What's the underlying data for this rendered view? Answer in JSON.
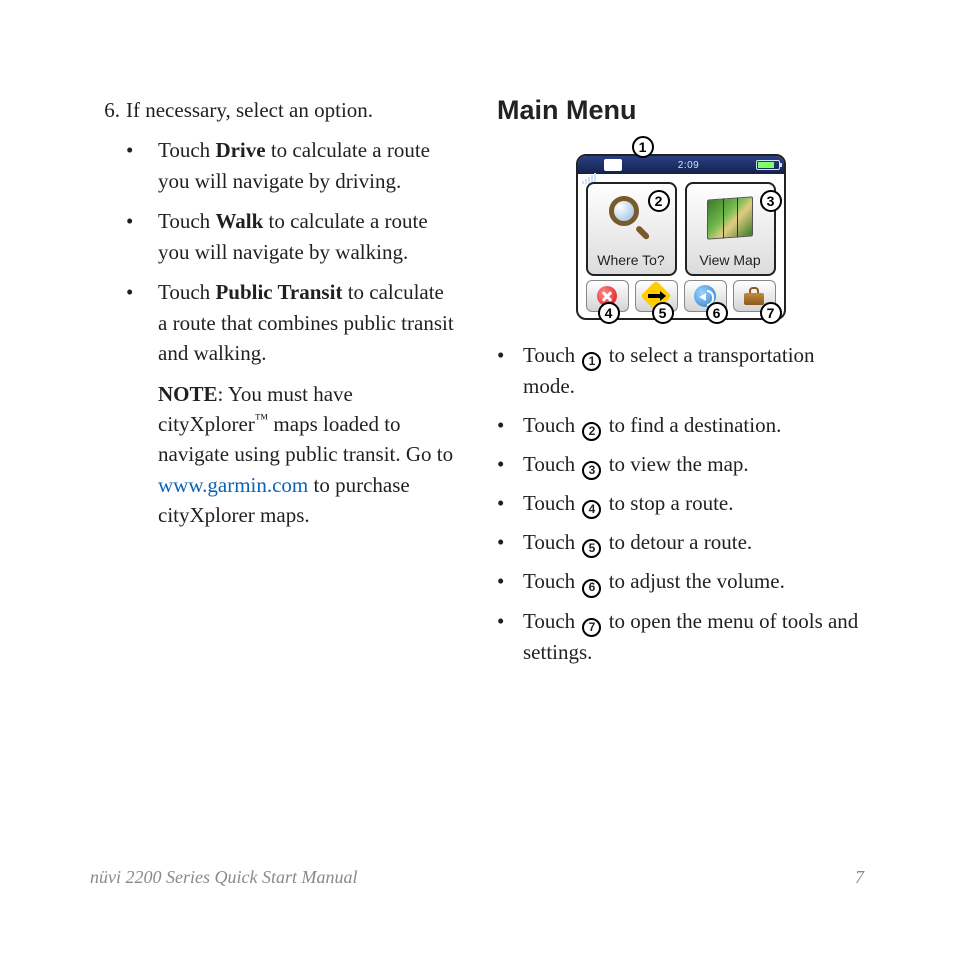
{
  "left": {
    "step_number": "6.",
    "step_text": "If necessary, select an option.",
    "options": [
      {
        "touch": "Touch ",
        "bold": "Drive",
        "rest": " to calculate a route you will navigate by driving."
      },
      {
        "touch": "Touch ",
        "bold": "Walk",
        "rest": " to calculate a route you will navigate by walking."
      },
      {
        "touch": "Touch ",
        "bold": "Public Transit",
        "rest": " to calculate a route that combines public transit and walking."
      }
    ],
    "note": {
      "label": "NOTE",
      "colon": ": ",
      "text1": "You must have cityXplorer",
      "tm": "™",
      "text2": " maps loaded to navigate using public transit. Go to ",
      "link_text": "www.garmin.com",
      "text3": " to purchase cityXplorer maps."
    }
  },
  "right": {
    "heading": "Main Menu",
    "device": {
      "time": "2:09",
      "tile1_label": "Where To?",
      "tile2_label": "View Map"
    },
    "icons": {
      "search": "search-icon",
      "map": "map-icon",
      "stop": "stop-icon",
      "detour": "detour-icon",
      "volume": "volume-icon",
      "tools": "tools-icon",
      "signal": "signal-icon",
      "mode": "transport-mode-icon",
      "battery": "battery-icon"
    },
    "overlay_numbers": [
      "1",
      "2",
      "3",
      "4",
      "5",
      "6",
      "7"
    ],
    "callouts": [
      {
        "pre": "Touch ",
        "num": "1",
        "post": " to select a transportation mode."
      },
      {
        "pre": "Touch ",
        "num": "2",
        "post": " to find a destination."
      },
      {
        "pre": "Touch ",
        "num": "3",
        "post": " to view the map."
      },
      {
        "pre": "Touch ",
        "num": "4",
        "post": " to stop a route."
      },
      {
        "pre": "Touch ",
        "num": "5",
        "post": " to detour a route."
      },
      {
        "pre": "Touch ",
        "num": "6",
        "post": " to adjust the volume."
      },
      {
        "pre": "Touch ",
        "num": "7",
        "post": " to open the menu of tools and settings."
      }
    ]
  },
  "footer": {
    "left": "nüvi 2200 Series Quick Start Manual",
    "right": "7"
  }
}
